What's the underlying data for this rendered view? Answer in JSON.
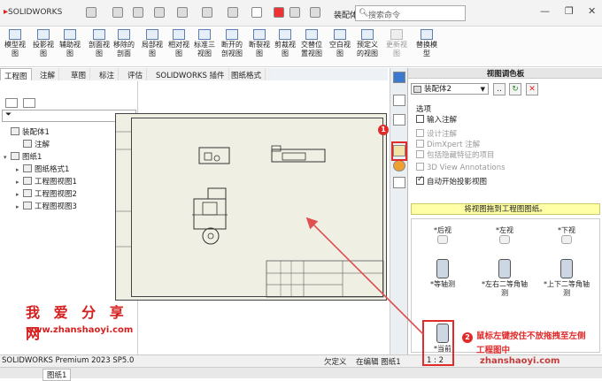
{
  "app": {
    "logo": "SOLIDWORKS",
    "doc_title": "装配体...",
    "search_placeholder": "搜索命令"
  },
  "ribbon": [
    {
      "label": "模型视\n图",
      "enabled": true
    },
    {
      "label": "投影视\n图",
      "enabled": true
    },
    {
      "label": "辅助视\n图",
      "enabled": true
    },
    {
      "label": "剖面视\n图",
      "enabled": true
    },
    {
      "label": "移除的\n剖面",
      "enabled": true
    },
    {
      "label": "局部视\n图",
      "enabled": true
    },
    {
      "label": "相对视\n图",
      "enabled": true
    },
    {
      "label": "标准三\n视图",
      "enabled": true
    },
    {
      "label": "断开的\n剖视图",
      "enabled": true
    },
    {
      "label": "断裂视\n图",
      "enabled": true
    },
    {
      "label": "剪裁视\n图",
      "enabled": true
    },
    {
      "label": "交替位\n置视图",
      "enabled": true
    },
    {
      "label": "空白视\n图",
      "enabled": true
    },
    {
      "label": "预定义\n的视图",
      "enabled": true
    },
    {
      "label": "更新视\n图",
      "enabled": false
    },
    {
      "label": "替换模\n型",
      "enabled": true
    }
  ],
  "tabs": [
    "工程图",
    "注解",
    "草图",
    "标注",
    "评估",
    "SOLIDWORKS 插件",
    "图纸格式"
  ],
  "tree": [
    {
      "label": "装配体1",
      "level": 0,
      "toggle": ""
    },
    {
      "label": "注解",
      "level": 1,
      "toggle": ""
    },
    {
      "label": "图纸1",
      "level": 0,
      "toggle": "▾"
    },
    {
      "label": "图纸格式1",
      "level": 1,
      "toggle": "▸"
    },
    {
      "label": "工程图视图1",
      "level": 1,
      "toggle": "▸"
    },
    {
      "label": "工程图视图2",
      "level": 1,
      "toggle": "▸"
    },
    {
      "label": "工程图视图3",
      "level": 1,
      "toggle": "▸"
    }
  ],
  "watermark": {
    "title": "我 爱 分 享 网",
    "url": "www.zhanshaoyi.com"
  },
  "palette": {
    "title": "视图调色板",
    "select": "装配体2",
    "options_title": "选项",
    "options": [
      {
        "label": "输入注解",
        "checked": false,
        "enabled": true
      },
      {
        "label": "设计注解",
        "checked": false,
        "enabled": false
      },
      {
        "label": "DimXpert 注解",
        "checked": false,
        "enabled": false
      },
      {
        "label": "包括隐藏特征的项目",
        "checked": false,
        "enabled": false
      },
      {
        "label": "3D View Annotations",
        "checked": false,
        "enabled": false
      },
      {
        "label": "自动开始投影视图",
        "checked": true,
        "enabled": true
      }
    ],
    "hint": "将视图拖到工程图图纸。",
    "views": [
      {
        "label": "*后视",
        "kind": "sm"
      },
      {
        "label": "*左视",
        "kind": "sm"
      },
      {
        "label": "*下视",
        "kind": "sm"
      },
      {
        "label": "*等轴测",
        "kind": "iso"
      },
      {
        "label": "*左右二等角轴\n测",
        "kind": "iso"
      },
      {
        "label": "*上下二等角轴\n测",
        "kind": "iso"
      },
      {
        "label": "*当前",
        "kind": "iso"
      }
    ]
  },
  "annotations": {
    "badge1": "1",
    "badge2": "2",
    "callout": "鼠标左键按住不放拖拽至左侧\n工程图中"
  },
  "status": {
    "version": "SOLIDWORKS Premium 2023 SP5.0",
    "state1": "欠定义",
    "state2": "在编辑 图纸1",
    "scale": "1 : 2",
    "sheet_tab": "图纸1",
    "wm": "zhanshaoyi.com"
  }
}
